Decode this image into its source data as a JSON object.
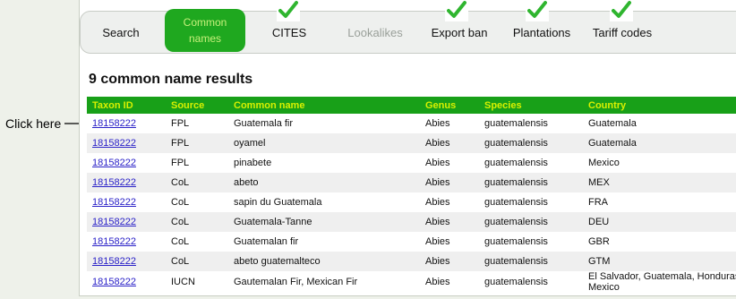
{
  "annotation": {
    "text": "Click here"
  },
  "tabs": [
    {
      "label": "Search",
      "state": "normal",
      "checked": false
    },
    {
      "label_line1": "Common",
      "label_line2": "names",
      "state": "active",
      "checked": false
    },
    {
      "label": "CITES",
      "state": "normal",
      "checked": true
    },
    {
      "label": "Lookalikes",
      "state": "disabled",
      "checked": false
    },
    {
      "label": "Export ban",
      "state": "normal",
      "checked": true
    },
    {
      "label": "Plantations",
      "state": "normal",
      "checked": true
    },
    {
      "label": "Tariff codes",
      "state": "normal",
      "checked": true
    }
  ],
  "results": {
    "title": "9 common name results",
    "columns": [
      "Taxon ID",
      "Source",
      "Common name",
      "Genus",
      "Species",
      "Country"
    ],
    "rows": [
      [
        "18158222",
        "FPL",
        "Guatemala fir",
        "Abies",
        "guatemalensis",
        "Guatemala"
      ],
      [
        "18158222",
        "FPL",
        "oyamel",
        "Abies",
        "guatemalensis",
        "Guatemala"
      ],
      [
        "18158222",
        "FPL",
        "pinabete",
        "Abies",
        "guatemalensis",
        "Mexico"
      ],
      [
        "18158222",
        "CoL",
        "abeto",
        "Abies",
        "guatemalensis",
        "MEX"
      ],
      [
        "18158222",
        "CoL",
        "sapin du Guatemala",
        "Abies",
        "guatemalensis",
        "FRA"
      ],
      [
        "18158222",
        "CoL",
        "Guatemala-Tanne",
        "Abies",
        "guatemalensis",
        "DEU"
      ],
      [
        "18158222",
        "CoL",
        "Guatemalan fir",
        "Abies",
        "guatemalensis",
        "GBR"
      ],
      [
        "18158222",
        "CoL",
        "abeto guatemalteco",
        "Abies",
        "guatemalensis",
        "GTM"
      ],
      [
        "18158222",
        "IUCN",
        "Gautemalan Fir, Mexican Fir",
        "Abies",
        "guatemalensis",
        "El Salvador, Guatemala, Honduras, Mexico"
      ]
    ]
  },
  "colors": {
    "accent_green": "#1fa81f",
    "header_text": "#d8f000",
    "link": "#2b22c8",
    "check_green": "#2fb52f"
  }
}
